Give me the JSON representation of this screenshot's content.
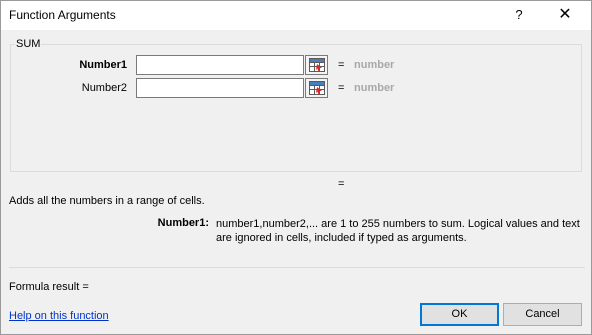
{
  "window": {
    "title": "Function Arguments",
    "help_glyph": "?",
    "close_glyph": "✕"
  },
  "function": {
    "name": "SUM",
    "args": [
      {
        "label": "Number1",
        "value": "",
        "result_equals": "=",
        "result": "number",
        "active": true
      },
      {
        "label": "Number2",
        "value": "",
        "result_equals": "=",
        "result": "number",
        "active": false
      }
    ],
    "result_equals": "=",
    "description": "Adds all the numbers in a range of cells.",
    "arg_help": {
      "name": "Number1:",
      "text": "number1,number2,... are 1 to 255 numbers to sum. Logical values and text are ignored in cells, included if typed as arguments."
    }
  },
  "footer": {
    "formula_result": "Formula result =",
    "help_link": "Help on this function",
    "ok_label": "OK",
    "cancel_label": "Cancel"
  },
  "icons": {
    "range_selector": "collapse-dialog-icon"
  },
  "colors": {
    "link": "#0033cc",
    "result_text": "#a8a8a8",
    "ok_border": "#0078d7"
  }
}
